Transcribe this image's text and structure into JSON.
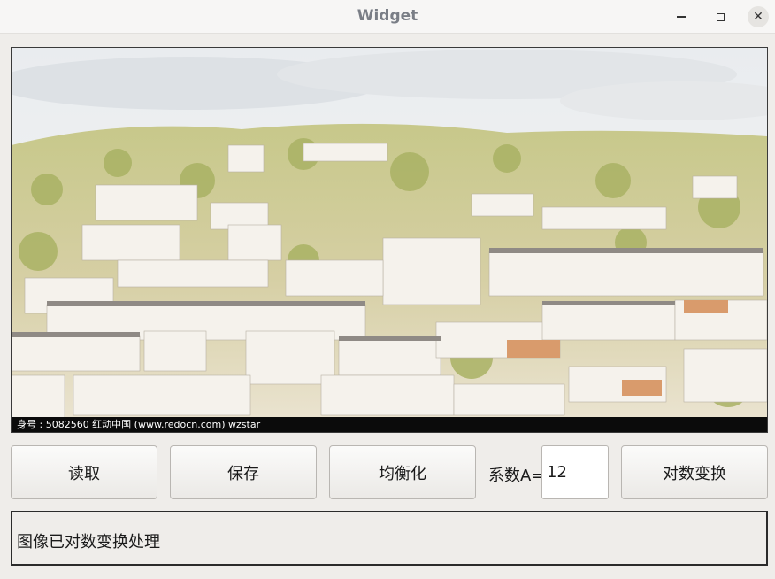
{
  "window": {
    "title": "Widget",
    "minimize_icon": "minimize-icon",
    "maximize_icon": "maximize-icon",
    "close_icon": "close-icon"
  },
  "image": {
    "description_icon": "photo-hillside-town",
    "watermark": "身号 : 5082560    红动中国 (www.redocn.com)    wzstar"
  },
  "controls": {
    "read_label": "读取",
    "save_label": "保存",
    "equalize_label": "均衡化",
    "coef_label": "系数A=",
    "coef_value": "12",
    "log_label": "对数变换"
  },
  "status": {
    "text": "图像已对数变换处理"
  }
}
